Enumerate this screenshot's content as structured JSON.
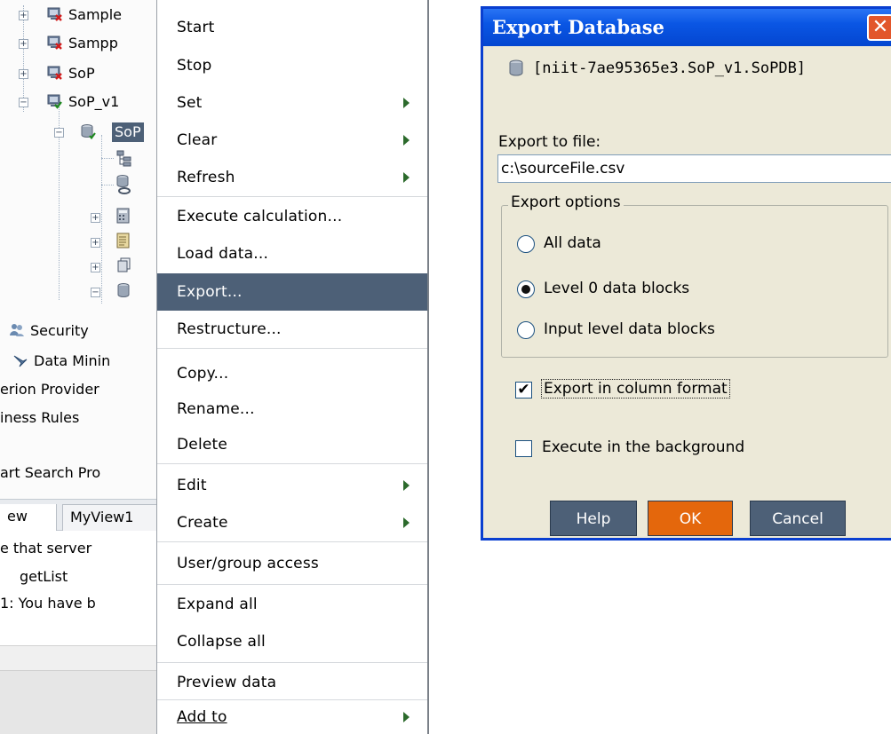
{
  "tree": {
    "nodes": [
      {
        "label": "Sample",
        "expander": "+",
        "icon": "server-error-icon"
      },
      {
        "label": "Sampp",
        "expander": "+",
        "icon": "server-error-icon"
      },
      {
        "label": "SoP",
        "expander": "+",
        "icon": "server-error-icon"
      },
      {
        "label": "SoP_v1",
        "expander": "−",
        "icon": "server-ok-icon"
      },
      {
        "label": "SoP",
        "expander": "−",
        "icon": "database-icon"
      }
    ],
    "security_label": "Security",
    "datamining_label": "Data Minin",
    "provider_label": "erion Provider",
    "rules_label": "iness Rules",
    "search_label": "art Search Pro"
  },
  "tabs": [
    {
      "label": "ew"
    },
    {
      "label": "MyView1"
    }
  ],
  "log": {
    "line1": "e that server",
    "line2": "getList",
    "line3": "1: You have b"
  },
  "menu": {
    "items": [
      {
        "label": "Start",
        "submenu": false
      },
      {
        "label": "Stop",
        "submenu": false
      },
      {
        "label": "Set",
        "submenu": true
      },
      {
        "label": "Clear",
        "submenu": true
      },
      {
        "label": "Refresh",
        "submenu": true
      },
      {
        "label": "Execute calculation...",
        "submenu": false
      },
      {
        "label": "Load data...",
        "submenu": false
      },
      {
        "label": "Export...",
        "submenu": false
      },
      {
        "label": "Restructure...",
        "submenu": false
      },
      {
        "label": "Copy...",
        "submenu": false
      },
      {
        "label": "Rename...",
        "submenu": false
      },
      {
        "label": "Delete",
        "submenu": false
      },
      {
        "label": "Edit",
        "submenu": true
      },
      {
        "label": "Create",
        "submenu": true
      },
      {
        "label": "User/group access",
        "submenu": false
      },
      {
        "label": "Expand all",
        "submenu": false
      },
      {
        "label": "Collapse all",
        "submenu": false
      },
      {
        "label": "Preview data",
        "submenu": false
      },
      {
        "label": "Add to",
        "submenu": true
      }
    ],
    "selected": "Export..."
  },
  "dialog": {
    "title": "Export Database",
    "close_glyph": "✕",
    "database": "[niit-7ae95365e3.SoP_v1.SoPDB]",
    "export_to_label": "Export to file:",
    "file_value": "c:\\sourceFile.csv",
    "options_legend": "Export options",
    "options": [
      {
        "label": "All data",
        "checked": false
      },
      {
        "label": "Level 0 data blocks",
        "checked": true
      },
      {
        "label": "Input level data blocks",
        "checked": false
      }
    ],
    "column_format_label": "Export in column format",
    "column_format_checked": true,
    "background_label": "Execute in the background",
    "background_checked": false,
    "buttons": {
      "help": "Help",
      "ok": "OK",
      "cancel": "Cancel"
    },
    "check_glyph": "✔"
  },
  "colors": {
    "menu_selected": "#4d6077",
    "titlebar": "#0a56e4",
    "ok_button": "#e4670c",
    "button": "#4d6077",
    "dialog_bg": "#ece9d8"
  }
}
